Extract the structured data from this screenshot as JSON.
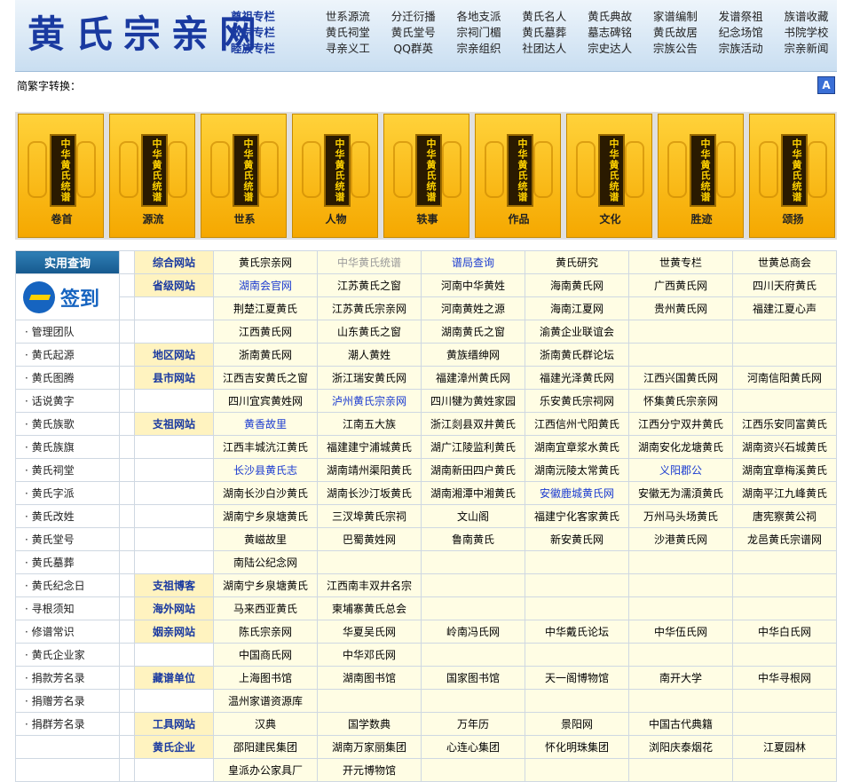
{
  "header": {
    "logo": "黄氏宗亲网",
    "nav": [
      {
        "title": "尊祖专栏",
        "items": [
          "世系源流",
          "分迁衍播",
          "各地支派",
          "黄氏名人",
          "黄氏典故",
          "家谱编制",
          "发谱祭祖",
          "族谱收藏"
        ]
      },
      {
        "title": "敬宗专栏",
        "items": [
          "黄氏祠堂",
          "黄氏堂号",
          "宗祠门楣",
          "黄氏墓葬",
          "墓志碑铭",
          "黄氏故居",
          "纪念场馆",
          "书院学校"
        ]
      },
      {
        "title": "睦族专栏",
        "items": [
          "寻亲义工",
          "QQ群英",
          "宗亲组织",
          "社团达人",
          "宗史达人",
          "宗族公告",
          "宗族活动",
          "宗亲新闻"
        ]
      }
    ]
  },
  "convert": {
    "label": "简繁字转换：",
    "button": "A"
  },
  "cards": [
    {
      "panel": "中华黄氏统谱",
      "label": "卷首"
    },
    {
      "panel": "中华黄氏统谱",
      "label": "源流"
    },
    {
      "panel": "中华黄氏统谱",
      "label": "世系"
    },
    {
      "panel": "中华黄氏统谱",
      "label": "人物"
    },
    {
      "panel": "中华黄氏统谱",
      "label": "轶事"
    },
    {
      "panel": "中华黄氏统谱",
      "label": "作品"
    },
    {
      "panel": "中华黄氏统谱",
      "label": "文化"
    },
    {
      "panel": "中华黄氏统谱",
      "label": "胜迹"
    },
    {
      "panel": "中华黄氏统谱",
      "label": "颂扬"
    }
  ],
  "sidebar": {
    "title": "实用查询",
    "signin": "签到",
    "items": [
      "管理团队",
      "黄氏起源",
      "黄氏图腾",
      "话说黄字",
      "黄氏族歌",
      "黄氏族旗",
      "黄氏祠堂",
      "黄氏字派",
      "黄氏改姓",
      "黄氏堂号",
      "黄氏墓葬",
      "黄氏纪念日",
      "寻根须知",
      "修谱常识",
      "黄氏企业家",
      "捐款芳名录",
      "捐赠芳名录",
      "捐群芳名录"
    ]
  },
  "rows": [
    {
      "cat": "综合网站",
      "cells": [
        "黄氏宗亲网",
        "中华黄氏统谱",
        "谱局查询",
        "黄氏研究",
        "世黄专栏",
        "世黄总商会"
      ]
    },
    {
      "cat": "省级网站",
      "cells": [
        "湖南会官网",
        "江苏黄氏之窗",
        "河南中华黄姓",
        "海南黄氏网",
        "广西黄氏网",
        "四川天府黄氏"
      ]
    },
    {
      "cat": "",
      "cells": [
        "荆楚江夏黄氏",
        "江苏黄氏宗亲网",
        "河南黄姓之源",
        "海南江夏网",
        "贵州黄氏网",
        "福建江夏心声"
      ]
    },
    {
      "cat": "",
      "cells": [
        "江西黄氏网",
        "山东黄氏之窗",
        "湖南黄氏之窗",
        "渝黄企业联谊会",
        "",
        ""
      ]
    },
    {
      "cat": "地区网站",
      "cells": [
        "浙南黄氏网",
        "潮人黄姓",
        "黄族缙绅网",
        "浙南黄氏群论坛",
        "",
        ""
      ]
    },
    {
      "cat": "县市网站",
      "cells": [
        "江西吉安黄氏之窗",
        "浙江瑞安黄氏网",
        "福建漳州黄氏网",
        "福建光泽黄氏网",
        "江西兴国黄氏网",
        "河南信阳黄氏网"
      ]
    },
    {
      "cat": "",
      "cells": [
        "四川宜宾黄姓网",
        "泸州黄氏宗亲网",
        "四川犍为黄姓家园",
        "乐安黄氏宗祠网",
        "怀集黄氏宗亲网",
        ""
      ]
    },
    {
      "cat": "支祖网站",
      "cells": [
        "黄香故里",
        "江南五大族",
        "浙江剡县双井黄氏",
        "江西信州弋阳黄氏",
        "江西分宁双井黄氏",
        "江西乐安同富黄氏"
      ]
    },
    {
      "cat": "",
      "cells": [
        "江西丰城沆江黄氏",
        "福建建宁浦城黄氏",
        "湖广江陵监利黄氏",
        "湖南宜章浆水黄氏",
        "湖南安化龙塘黄氏",
        "湖南资兴石城黄氏"
      ]
    },
    {
      "cat": "",
      "cells": [
        "长沙县黄氏志",
        "湖南靖州渠阳黄氏",
        "湖南新田四户黄氏",
        "湖南沅陵太常黄氏",
        "义阳郡公",
        "湖南宜章梅溪黄氏"
      ]
    },
    {
      "cat": "",
      "cells": [
        "湖南长沙白沙黄氏",
        "湖南长沙汀坂黄氏",
        "湖南湘潭中湘黄氏",
        "安徽鹿城黄氏网",
        "安徽无为濡湏黄氏",
        "湖南平江九峰黄氏"
      ]
    },
    {
      "cat": "",
      "cells": [
        "湖南宁乡泉塘黄氏",
        "三汊埠黄氏宗祠",
        "文山阁",
        "福建宁化客家黄氏",
        "万州马头场黄氏",
        "唐宪察黄公祠"
      ]
    },
    {
      "cat": "",
      "cells": [
        "黄嵫故里",
        "巴蜀黄姓网",
        "鲁南黄氏",
        "新安黄氏网",
        "沙港黄氏网",
        "龙邑黄氏宗谱网"
      ]
    },
    {
      "cat": "",
      "cells": [
        "南陆公纪念网",
        "",
        "",
        "",
        "",
        ""
      ]
    },
    {
      "cat": "支祖博客",
      "cells": [
        "湖南宁乡泉塘黄氏",
        "江西南丰双井名宗",
        "",
        "",
        "",
        ""
      ]
    },
    {
      "cat": "海外网站",
      "cells": [
        "马来西亚黄氏",
        "柬埔寨黄氏总会",
        "",
        "",
        "",
        ""
      ]
    },
    {
      "cat": "姻亲网站",
      "cells": [
        "陈氏宗亲网",
        "华夏吴氏网",
        "岭南冯氏网",
        "中华戴氏论坛",
        "中华伍氏网",
        "中华白氏网"
      ]
    },
    {
      "cat": "",
      "cells": [
        "中国商氏网",
        "中华邓氏网",
        "",
        "",
        "",
        ""
      ]
    },
    {
      "cat": "藏谱单位",
      "cells": [
        "上海图书馆",
        "湖南图书馆",
        "国家图书馆",
        "天一阁博物馆",
        "南开大学",
        "中华寻根网"
      ]
    },
    {
      "cat": "",
      "cells": [
        "温州家谱资源库",
        "",
        "",
        "",
        "",
        ""
      ]
    },
    {
      "cat": "工具网站",
      "cells": [
        "汉典",
        "国学数典",
        "万年历",
        "景阳网",
        "中国古代典籍",
        ""
      ]
    },
    {
      "cat": "黄氏企业",
      "cells": [
        "邵阳建民集团",
        "湖南万家丽集团",
        "心连心集团",
        "怀化明珠集团",
        "浏阳庆泰烟花",
        "江夏园林"
      ]
    },
    {
      "cat": "",
      "cells": [
        "皇派办公家具厂",
        "开元博物馆",
        "",
        "",
        "",
        ""
      ]
    }
  ]
}
